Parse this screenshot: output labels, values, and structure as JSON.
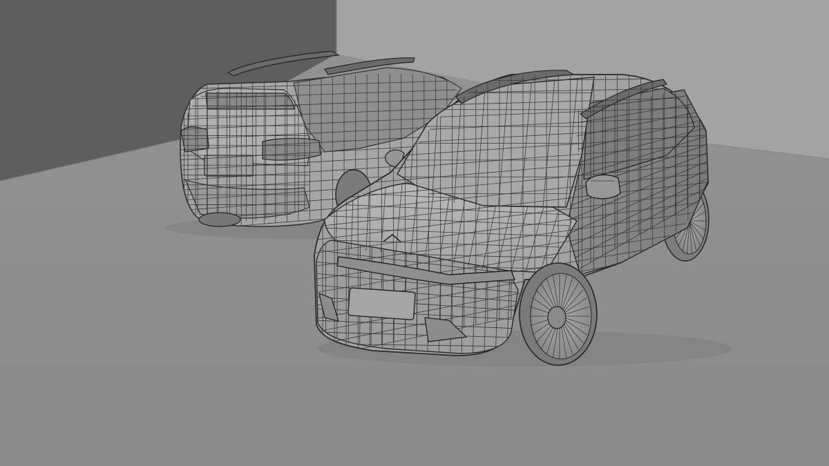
{
  "scene": {
    "colors": {
      "wall_left": "#5e5e5e",
      "wall_right": "#a3a3a3",
      "floor": "#8f8f8f",
      "body_light": "#b2b2b2",
      "body_mid": "#9c9c9c",
      "body_dark": "#7d7d7d",
      "glass": "#878787",
      "tire": "#6f6f6f",
      "wire": "#3a3a3a"
    },
    "objects": [
      {
        "name": "rear-suv-model",
        "kind": "wireframe 3D car model, rear three-quarter view"
      },
      {
        "name": "front-suv-model",
        "kind": "wireframe 3D car model, front three-quarter view"
      }
    ]
  }
}
